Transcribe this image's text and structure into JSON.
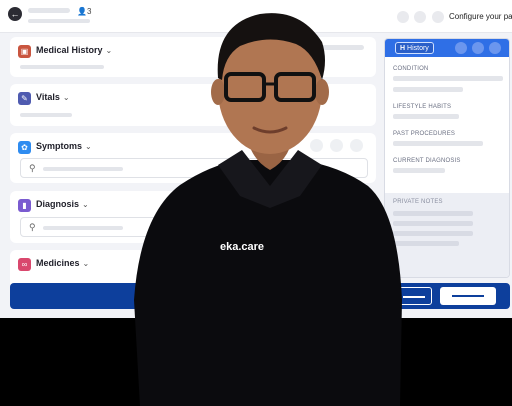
{
  "header": {
    "patient_count": "3",
    "configure_label": "Configure your pad"
  },
  "cards": {
    "medical_history": "Medical History",
    "vitals": "Vitals",
    "symptoms": "Symptoms",
    "diagnosis": "Diagnosis",
    "medicines": "Medicines"
  },
  "right_panel": {
    "tab_label": "History",
    "sections": [
      "CONDITION",
      "LIFESTYLE HABITS",
      "PAST PROCEDURES",
      "CURRENT DIAGNOSIS"
    ],
    "notes_label": "PRIVATE NOTES"
  },
  "brand": {
    "shirt_logo": "eka.care"
  },
  "colors": {
    "accent_blue": "#2f6fe6",
    "bottom_bar": "#0d3f9c",
    "medical_history_icon": "#c9553f",
    "vitals_icon": "#4f5bb0",
    "symptoms_icon": "#2f8cf0",
    "diagnosis_icon": "#7a5bd0",
    "medicines_icon": "#d9476d"
  },
  "icons": {
    "back": "arrow-left-icon",
    "patients": "person-icon",
    "search": "search-icon",
    "expand": "chevron-down-icon"
  }
}
